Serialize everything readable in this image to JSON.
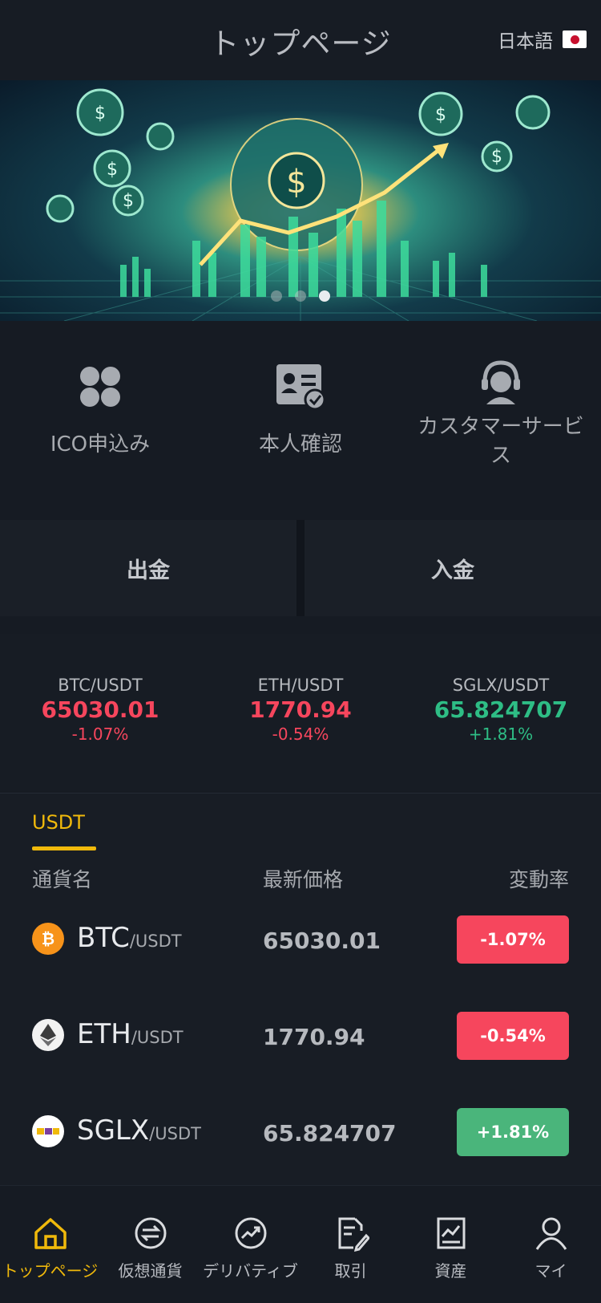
{
  "header": {
    "title": "トップページ",
    "language": "日本語"
  },
  "banner": {
    "slides": 3,
    "active_slide": 3
  },
  "quick_actions": [
    {
      "label": "ICO申込み",
      "icon": "grid-icon"
    },
    {
      "label": "本人確認",
      "icon": "id-card-icon"
    },
    {
      "label": "カスタマーサービス",
      "icon": "headset-icon"
    }
  ],
  "actions": {
    "withdraw": "出金",
    "deposit": "入金"
  },
  "tickers": [
    {
      "pair": "BTC/USDT",
      "price": "65030.01",
      "change": "-1.07%",
      "color": "#f6465d"
    },
    {
      "pair": "ETH/USDT",
      "price": "1770.94",
      "change": "-0.54%",
      "color": "#f6465d"
    },
    {
      "pair": "SGLX/USDT",
      "price": "65.824707",
      "change": "+1.81%",
      "color": "#2ebd85"
    }
  ],
  "market": {
    "tab": "USDT",
    "headers": {
      "name": "通貨名",
      "price": "最新価格",
      "change": "変動率"
    },
    "rows": [
      {
        "base": "BTC",
        "quote": "/USDT",
        "price": "65030.01",
        "change": "-1.07%",
        "color": "#f6465d",
        "icon": "bitcoin-icon"
      },
      {
        "base": "ETH",
        "quote": "/USDT",
        "price": "1770.94",
        "change": "-0.54%",
        "color": "#f6465d",
        "icon": "ethereum-icon"
      },
      {
        "base": "SGLX",
        "quote": "/USDT",
        "price": "65.824707",
        "change": "+1.81%",
        "color": "#4ab57b",
        "icon": "sglx-icon"
      }
    ]
  },
  "nav": [
    {
      "label": "トップページ",
      "icon": "home-icon",
      "active": true
    },
    {
      "label": "仮想通貨",
      "icon": "exchange-icon"
    },
    {
      "label": "デリバティブ",
      "icon": "trend-icon"
    },
    {
      "label": "取引",
      "icon": "order-edit-icon"
    },
    {
      "label": "資産",
      "icon": "assets-chart-icon"
    },
    {
      "label": "マイ",
      "icon": "user-icon"
    }
  ],
  "colors": {
    "accent": "#f0b90b",
    "down": "#f6465d",
    "up": "#2ebd85"
  }
}
